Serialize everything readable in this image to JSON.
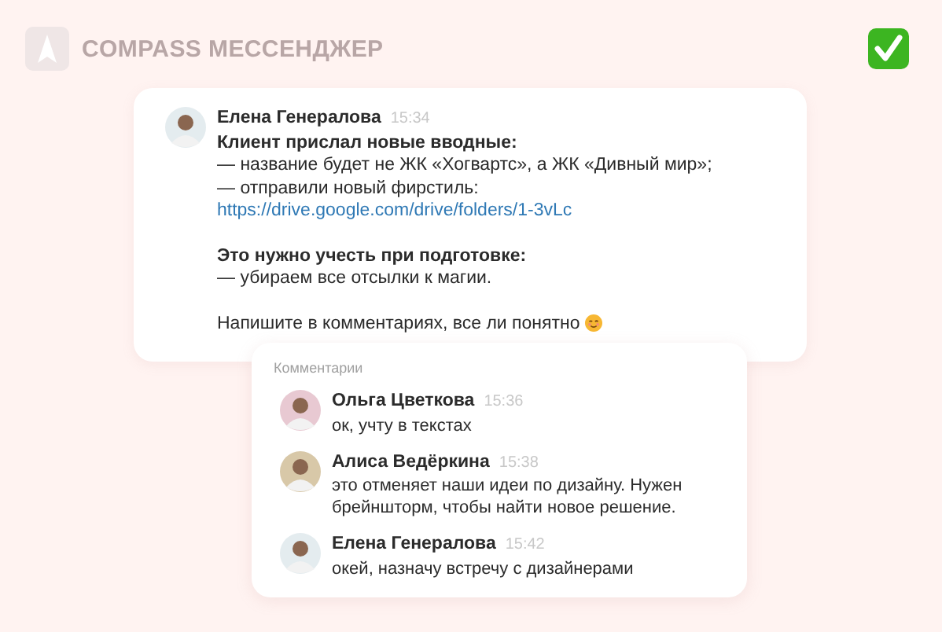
{
  "header": {
    "title": "COMPASS МЕССЕНДЖЕР"
  },
  "message": {
    "author": "Елена Генералова",
    "time": "15:34",
    "paragraphs": [
      [
        {
          "kind": "bold",
          "text": "Клиент прислал новые вводные:"
        },
        {
          "kind": "text",
          "text": "— название будет не ЖК «Хогвартс», а ЖК «Дивный мир»;"
        },
        {
          "kind": "text",
          "text": "— отправили новый фирстиль:"
        },
        {
          "kind": "link",
          "text": "https://drive.google.com/drive/folders/1-3vLc"
        }
      ],
      [
        {
          "kind": "bold",
          "text": "Это нужно учесть при подготовке:"
        },
        {
          "kind": "text",
          "text": "— убираем все отсылки к магии."
        }
      ],
      [
        {
          "kind": "emoji",
          "text": "Напишите в комментариях, все ли понятно"
        }
      ]
    ]
  },
  "comments": {
    "title": "Комментарии",
    "items": [
      {
        "author": "Ольга Цветкова",
        "time": "15:36",
        "text": "ок, учту в текстах",
        "color": "#e8c9d2"
      },
      {
        "author": "Алиса Ведёркина",
        "time": "15:38",
        "text": "это отменяет наши идеи по дизайну. Нужен брейншторм, чтобы найти новое решение.",
        "color": "#d8c8a8"
      },
      {
        "author": "Елена Генералова",
        "time": "15:42",
        "text": "окей, назначу встречу с дизайнерами",
        "color": "#e4ecef"
      }
    ]
  }
}
